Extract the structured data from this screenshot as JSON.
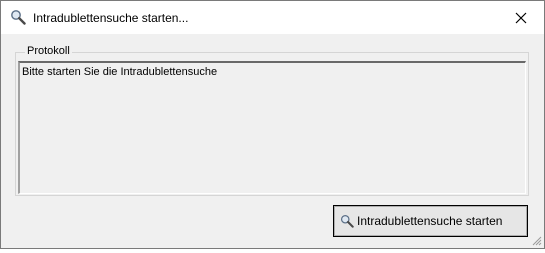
{
  "window": {
    "title": "Intradublettensuche starten..."
  },
  "icons": {
    "title_icon": "magnifier-icon",
    "close_icon": "close-icon",
    "button_icon": "magnifier-icon",
    "grip_icon": "size-grip-icon"
  },
  "protocol": {
    "legend": "Protokoll",
    "log_text": "Bitte starten Sie die Intradublettensuche"
  },
  "actions": {
    "start_button_label": "Intradublettensuche starten"
  }
}
